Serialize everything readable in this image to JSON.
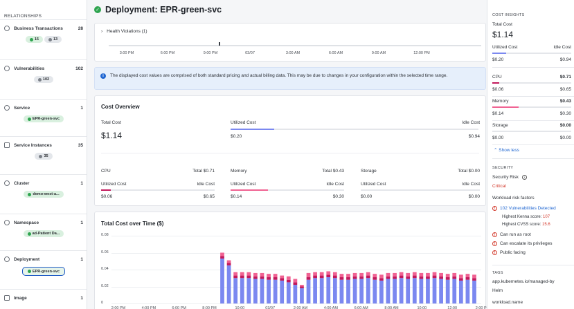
{
  "relationships": {
    "title": "RELATIONSHIPS",
    "items": [
      {
        "label": "Business Transactions",
        "count": "28",
        "chips": [
          {
            "text": "15",
            "kind": "green"
          },
          {
            "text": "13",
            "kind": "gray"
          }
        ]
      },
      {
        "label": "Vulnerabilities",
        "count": "102",
        "chips": [
          {
            "text": "102",
            "kind": "gray"
          }
        ]
      },
      {
        "label": "Service",
        "count": "1",
        "chips": [
          {
            "text": "EPR-green-svc",
            "kind": "green"
          }
        ]
      },
      {
        "label": "Service Instances",
        "count": "35",
        "chips": [
          {
            "text": "35",
            "kind": "gray"
          }
        ]
      },
      {
        "label": "Cluster",
        "count": "1",
        "chips": [
          {
            "text": "demo-west-a...",
            "kind": "green"
          }
        ]
      },
      {
        "label": "Namespace",
        "count": "1",
        "chips": [
          {
            "text": "ad-Patient Da...",
            "kind": "green"
          }
        ]
      },
      {
        "label": "Deployment",
        "count": "1",
        "chips": [
          {
            "text": "EPR-green-svc",
            "kind": "selected"
          }
        ]
      },
      {
        "label": "Image",
        "count": "1",
        "chips": []
      }
    ]
  },
  "header": {
    "title": "Deployment: EPR-green-svc"
  },
  "health": {
    "label": "Health Violations (1)",
    "timeline": [
      "3:00 PM",
      "6:00 PM",
      "9:00 PM",
      "03/07",
      "3:00 AM",
      "6:00 AM",
      "9:00 AM",
      "12:00 PM"
    ]
  },
  "info_banner": {
    "text": "The displayed cost values are comprised of both standard pricing and actual billing data. This may be due to changes in your configuration within the selected time range."
  },
  "cost_overview": {
    "title": "Cost Overview",
    "total_label": "Total Cost",
    "total_value": "$1.14",
    "utilized_label": "Utilized Cost",
    "idle_label": "Idle Cost",
    "utilized_value": "$0.20",
    "idle_value": "$0.94",
    "utilized_fraction": 0.175,
    "resources": [
      {
        "name": "CPU",
        "total": "Total $0.71",
        "utilized_label": "Utilized Cost",
        "idle_label": "Idle Cost",
        "utilized": "$0.06",
        "idle": "$0.65",
        "fraction": 0.085,
        "color": "#c2185b"
      },
      {
        "name": "Memory",
        "total": "Total $0.43",
        "utilized_label": "Utilized Cost",
        "idle_label": "Idle Cost",
        "utilized": "$0.14",
        "idle": "$0.30",
        "fraction": 0.33,
        "color": "#f06292"
      },
      {
        "name": "Storage",
        "total": "Total $0.00",
        "utilized_label": "Utilized Cost",
        "idle_label": "Idle Cost",
        "utilized": "$0.00",
        "idle": "$0.00",
        "fraction": 0,
        "color": "#9aa0a6"
      }
    ]
  },
  "chart_data": {
    "type": "bar",
    "title": "Total Cost over Time ($)",
    "ylim": [
      0,
      0.08
    ],
    "yticks": [
      "0.08",
      "0.06",
      "0.04",
      "0.02",
      "0"
    ],
    "xticks": [
      "2:00 PM",
      "4:00 PM",
      "6:00 PM",
      "8:00 PM",
      "10:00",
      "03/07",
      "2:00 AM",
      "4:00 AM",
      "6:00 AM",
      "8:00 AM",
      "10:00",
      "12:00",
      "2:00 PM"
    ],
    "series": [
      {
        "values": [
          0.053,
          0.045,
          0.03,
          0.03,
          0.03,
          0.029,
          0.029,
          0.028,
          0.028,
          0.027,
          0.025,
          0.022,
          0.018,
          0.028,
          0.03,
          0.03,
          0.031,
          0.03,
          0.028,
          0.028,
          0.029,
          0.029,
          0.03,
          0.028,
          0.027,
          0.029,
          0.029,
          0.03,
          0.029,
          0.03,
          0.029,
          0.029,
          0.03,
          0.029,
          0.028,
          0.029,
          0.027,
          0.028,
          0.027
        ]
      },
      {
        "values": [
          0.003,
          0.003,
          0.003,
          0.003,
          0.003,
          0.003,
          0.003,
          0.003,
          0.003,
          0.003,
          0.003,
          0.003,
          0.002,
          0.003,
          0.003,
          0.003,
          0.003,
          0.003,
          0.003,
          0.003,
          0.003,
          0.003,
          0.003,
          0.003,
          0.003,
          0.003,
          0.003,
          0.003,
          0.003,
          0.003,
          0.003,
          0.003,
          0.003,
          0.003,
          0.003,
          0.003,
          0.003,
          0.003,
          0.003
        ]
      },
      {
        "values": [
          0.004,
          0.003,
          0.004,
          0.004,
          0.004,
          0.004,
          0.004,
          0.004,
          0.004,
          0.003,
          0.004,
          0.004,
          0.002,
          0.005,
          0.004,
          0.004,
          0.004,
          0.004,
          0.004,
          0.004,
          0.004,
          0.004,
          0.004,
          0.004,
          0.004,
          0.004,
          0.004,
          0.004,
          0.004,
          0.004,
          0.004,
          0.004,
          0.004,
          0.004,
          0.004,
          0.004,
          0.004,
          0.004,
          0.004
        ]
      }
    ],
    "colors": [
      "#7b88f0",
      "#c2185b",
      "#f06292"
    ]
  },
  "insights": {
    "title": "COST INSIGHTS",
    "total_label": "Total Cost",
    "total_value": "$1.14",
    "utilized_label": "Utilized Cost",
    "idle_label": "Idle Cost",
    "utilized_value": "$0.20",
    "idle_value": "$0.94",
    "utilized_fraction": 0.175,
    "resources": [
      {
        "name": "CPU",
        "total": "$0.71",
        "utilized": "$0.06",
        "idle": "$0.65",
        "fraction": 0.085,
        "color": "#c2185b"
      },
      {
        "name": "Memory",
        "total": "$0.43",
        "utilized": "$0.14",
        "idle": "$0.30",
        "fraction": 0.33,
        "color": "#f06292"
      },
      {
        "name": "Storage",
        "total": "$0.00",
        "utilized": "$0.00",
        "idle": "$0.00",
        "fraction": 0,
        "color": "#9aa0a6"
      }
    ],
    "show_less": "Show less"
  },
  "security": {
    "title": "SECURITY",
    "risk_label": "Security Risk",
    "risk_value": "Critical",
    "factors_label": "Workload risk factors",
    "vulns": "102 Vulnerabilities Detected",
    "kenna_label": "Highest Kenna score:",
    "kenna_value": "107",
    "cvss_label": "Highest CVSS score:",
    "cvss_value": "15.6",
    "factors": [
      "Can run as root",
      "Can escalate its privileges",
      "Public facing"
    ]
  },
  "tags": {
    "title": "TAGS",
    "items": [
      {
        "key": "app.kubernetes.io/managed-by",
        "value": "Helm"
      },
      {
        "key": "workload.name",
        "value": ""
      }
    ]
  }
}
